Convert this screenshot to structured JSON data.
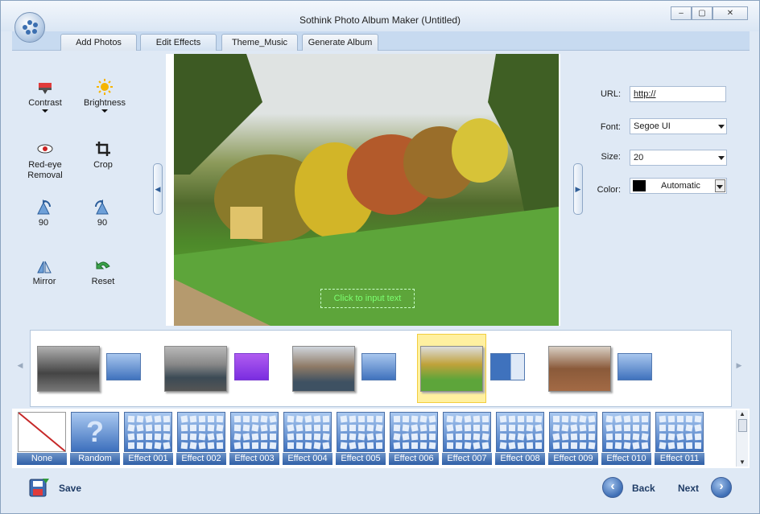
{
  "window": {
    "title": "Sothink Photo Album Maker (Untitled)",
    "controls": {
      "minimize": "–",
      "maximize": "▢",
      "close": "✕"
    }
  },
  "tabs": [
    {
      "label": "Add Photos"
    },
    {
      "label": "Edit Effects"
    },
    {
      "label": "Theme_Music"
    },
    {
      "label": "Generate Album"
    }
  ],
  "tools": {
    "contrast": "Contrast",
    "brightness": "Brightness",
    "redeye_line1": "Red-eye",
    "redeye_line2": "Removal",
    "crop": "Crop",
    "rotate_left": "90",
    "rotate_right": "90",
    "mirror": "Mirror",
    "reset": "Reset"
  },
  "preview": {
    "caption_placeholder": "Click to input text"
  },
  "text_props": {
    "url_label": "URL:",
    "url_value": "http://",
    "font_label": "Font:",
    "font_value": "Segoe UI",
    "size_label": "Size:",
    "size_value": "20",
    "color_label": "Color:",
    "color_value": "Automatic",
    "color_swatch": "#000000"
  },
  "effects": [
    "None",
    "Random",
    "Effect 001",
    "Effect 002",
    "Effect 003",
    "Effect 004",
    "Effect 005",
    "Effect 006",
    "Effect 007",
    "Effect 008",
    "Effect 009",
    "Effect 010",
    "Effect 011"
  ],
  "bottom": {
    "save": "Save",
    "back": "Back",
    "next": "Next"
  },
  "colors": {
    "accent": "#2f5fa6",
    "selection": "#fff0a0",
    "caption": "#7cff70"
  }
}
